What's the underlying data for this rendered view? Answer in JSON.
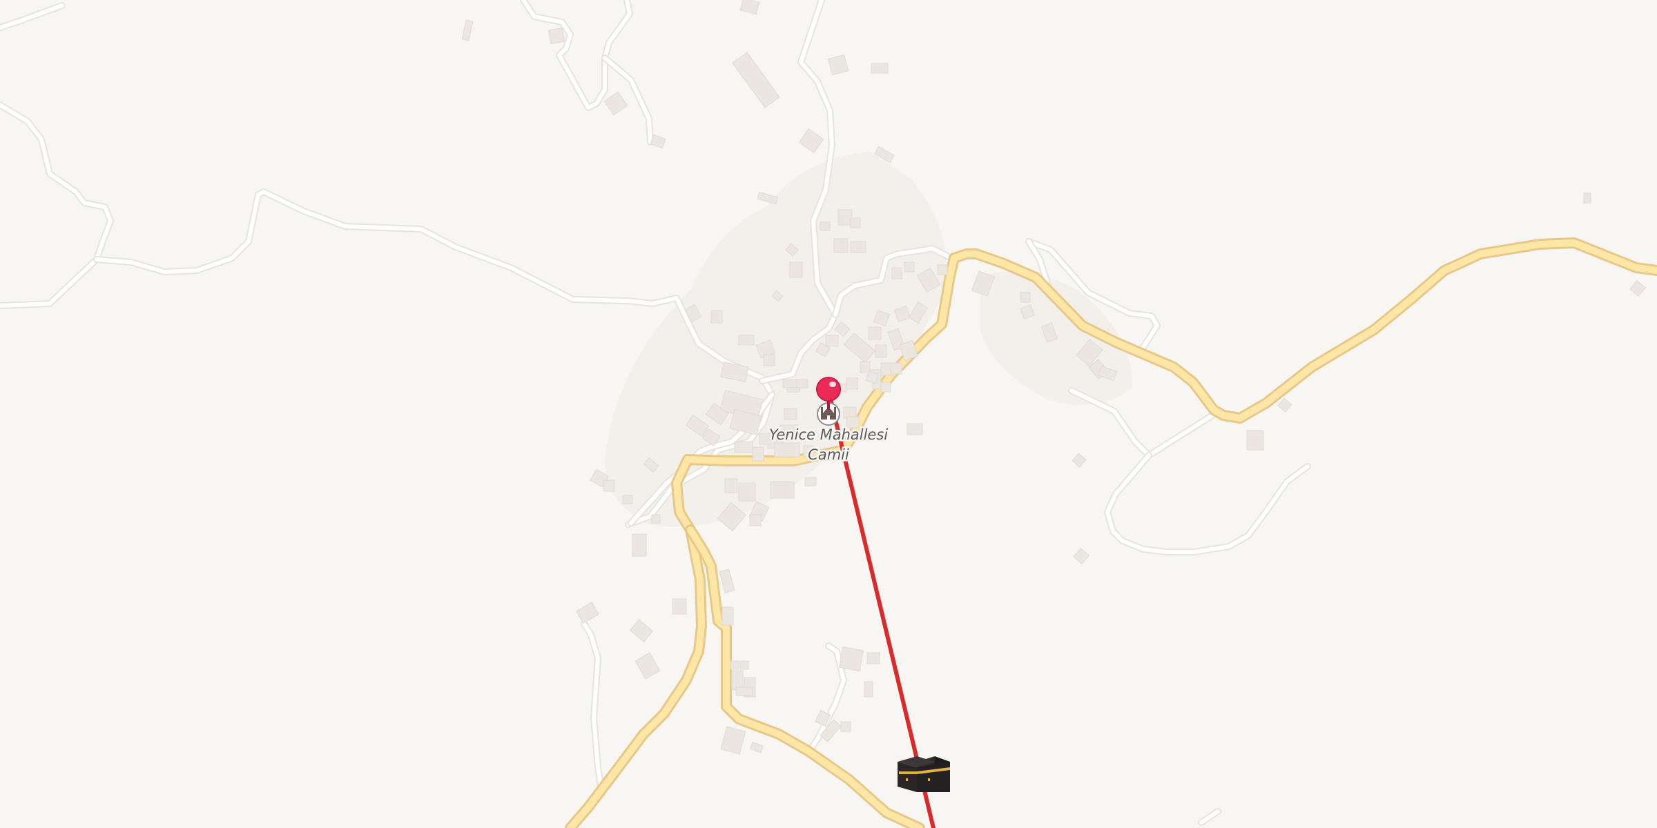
{
  "map": {
    "poi_label": {
      "line1": "Yenice Mahallesi",
      "line2": "Camii"
    },
    "icons": {
      "pin": "map-pin-icon",
      "mosque": "mosque-icon",
      "qibla_target": "kaaba-icon"
    },
    "colors": {
      "background": "#f8f6f2",
      "road_fill": "#ffffff",
      "main_road_fill": "#fde6a6",
      "main_road_casing": "#e7c889",
      "qibla_line": "#d92b2b",
      "pin": "#ec2a57",
      "building": "#ebe6df"
    }
  }
}
